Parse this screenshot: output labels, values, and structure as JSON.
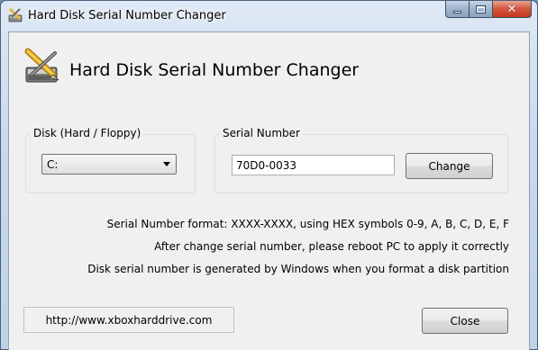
{
  "window": {
    "title": "Hard Disk Serial Number Changer",
    "caption_buttons": {
      "minimize": "minimize-icon",
      "maximize": "maximize-icon",
      "close": "✕"
    }
  },
  "header": {
    "title": "Hard Disk Serial Number Changer",
    "icon": "disk-pencil-icon"
  },
  "disk_group": {
    "label": "Disk (Hard / Floppy)",
    "selected": "C:"
  },
  "serial_group": {
    "label": "Serial Number",
    "value": "70D0-0033",
    "change_label": "Change"
  },
  "info": {
    "line1": "Serial Number format: XXXX-XXXX, using HEX symbols 0-9, A, B, C, D, E, F",
    "line2": "After change serial number, please reboot PC to apply it correctly",
    "line3": "Disk serial number is generated by Windows when you format a disk partition"
  },
  "footer": {
    "link": "http://www.xboxharddrive.com",
    "close_label": "Close"
  },
  "colors": {
    "titlebar": "#c9d9ec",
    "client_bg": "#f0f0f0",
    "close_button": "#c1391d"
  }
}
